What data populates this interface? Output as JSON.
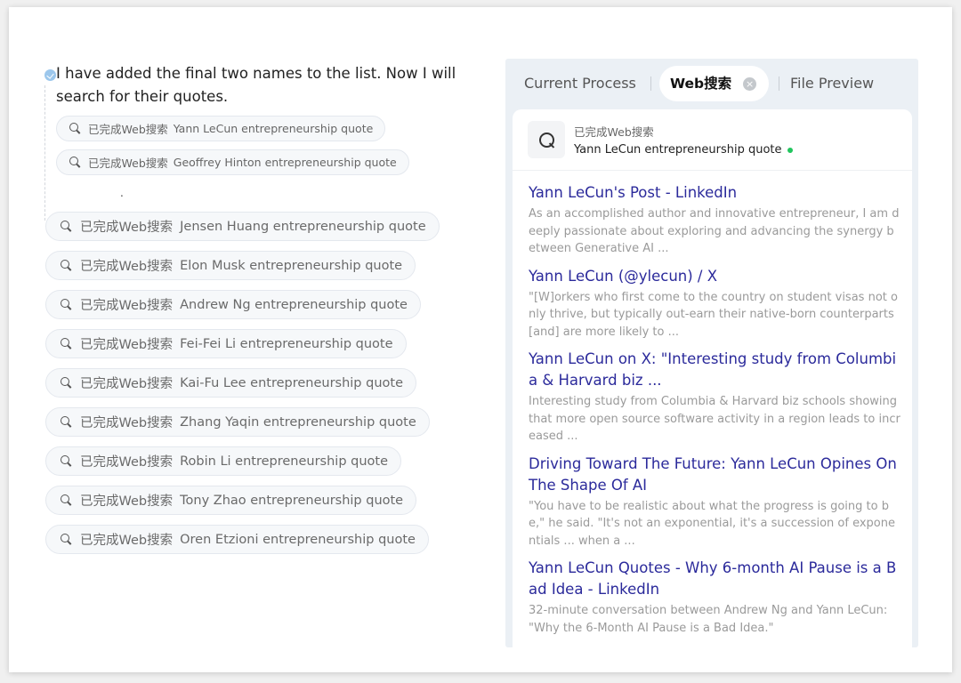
{
  "thought": {
    "text": "I have added the final two names to the list. Now I will search for their quotes.",
    "sub_searches": [
      {
        "status": "已完成Web搜索",
        "query": "Yann LeCun entrepreneurship quote"
      },
      {
        "status": "已完成Web搜索",
        "query": "Geoffrey Hinton entrepreneurship quote"
      }
    ],
    "trailing_mark": "."
  },
  "searches": [
    {
      "status": "已完成Web搜索",
      "query": "Jensen Huang entrepreneurship quote"
    },
    {
      "status": "已完成Web搜索",
      "query": "Elon Musk entrepreneurship quote"
    },
    {
      "status": "已完成Web搜索",
      "query": "Andrew Ng entrepreneurship quote"
    },
    {
      "status": "已完成Web搜索",
      "query": "Fei-Fei Li entrepreneurship quote"
    },
    {
      "status": "已完成Web搜索",
      "query": "Kai-Fu Lee entrepreneurship quote"
    },
    {
      "status": "已完成Web搜索",
      "query": "Zhang Yaqin entrepreneurship quote"
    },
    {
      "status": "已完成Web搜索",
      "query": "Robin Li entrepreneurship quote"
    },
    {
      "status": "已完成Web搜索",
      "query": "Tony Zhao entrepreneurship quote"
    },
    {
      "status": "已完成Web搜索",
      "query": "Oren Etzioni entrepreneurship quote"
    }
  ],
  "panel": {
    "tabs": {
      "current": "Current Process",
      "web": "Web搜索",
      "close_glyph": "×",
      "file": "File Preview"
    },
    "header": {
      "status": "已完成Web搜索",
      "query": "Yann LeCun entrepreneurship quote",
      "status_color": "#22c55e"
    },
    "results": [
      {
        "title": "Yann LeCun's Post - LinkedIn",
        "snippet": "As an accomplished author and innovative entrepreneur, I am deeply passionate about exploring and advancing the synergy between Generative AI ..."
      },
      {
        "title": "Yann LeCun (@ylecun) / X",
        "snippet": "\"[W]orkers who first come to the country on student visas not only thrive, but typically out-earn their native-born counterparts [and] are more likely to ..."
      },
      {
        "title": "Yann LeCun on X: \"Interesting study from Columbia & Harvard biz ...",
        "snippet": "Interesting study from Columbia & Harvard biz schools showing that more open source software activity in a region leads to incr eased ..."
      },
      {
        "title": "Driving Toward The Future: Yann LeCun Opines On The Shape Of AI",
        "snippet": "\"You have to be realistic about what the progress is going to be,\" he said. \"It's not an exponential, it's a succession of exponentials ... when a ..."
      },
      {
        "title": "Yann LeCun Quotes - Why 6-month AI Pause is a Bad Idea - LinkedIn",
        "snippet": "32-minute conversation between Andrew Ng and Yann LeCun: \"Why the 6-Month AI Pause is a Bad Idea.\""
      }
    ]
  },
  "colors": {
    "link": "#2b2a9b",
    "snippet": "#9a9a9a",
    "panel_bg": "#ebf0f5"
  }
}
